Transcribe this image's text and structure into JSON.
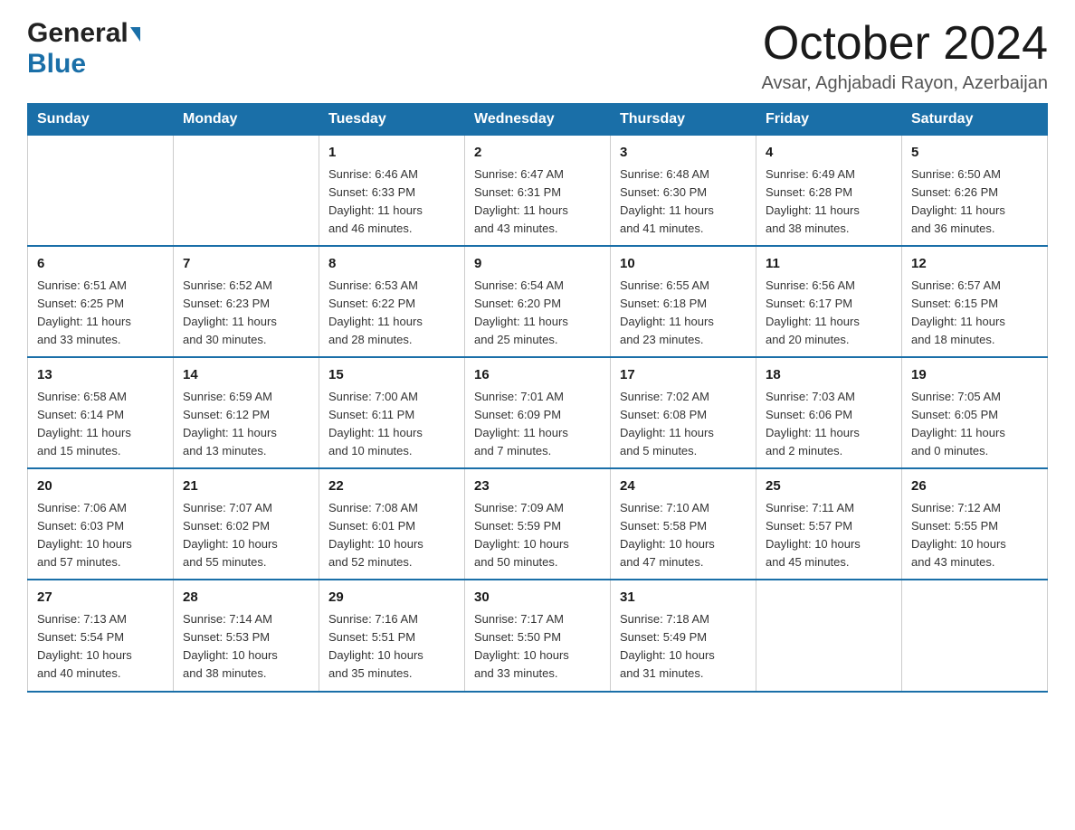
{
  "header": {
    "logo_general": "General",
    "logo_blue": "Blue",
    "month_title": "October 2024",
    "location": "Avsar, Aghjabadi Rayon, Azerbaijan"
  },
  "calendar": {
    "days_of_week": [
      "Sunday",
      "Monday",
      "Tuesday",
      "Wednesday",
      "Thursday",
      "Friday",
      "Saturday"
    ],
    "weeks": [
      [
        {
          "day": "",
          "info": ""
        },
        {
          "day": "",
          "info": ""
        },
        {
          "day": "1",
          "info": "Sunrise: 6:46 AM\nSunset: 6:33 PM\nDaylight: 11 hours\nand 46 minutes."
        },
        {
          "day": "2",
          "info": "Sunrise: 6:47 AM\nSunset: 6:31 PM\nDaylight: 11 hours\nand 43 minutes."
        },
        {
          "day": "3",
          "info": "Sunrise: 6:48 AM\nSunset: 6:30 PM\nDaylight: 11 hours\nand 41 minutes."
        },
        {
          "day": "4",
          "info": "Sunrise: 6:49 AM\nSunset: 6:28 PM\nDaylight: 11 hours\nand 38 minutes."
        },
        {
          "day": "5",
          "info": "Sunrise: 6:50 AM\nSunset: 6:26 PM\nDaylight: 11 hours\nand 36 minutes."
        }
      ],
      [
        {
          "day": "6",
          "info": "Sunrise: 6:51 AM\nSunset: 6:25 PM\nDaylight: 11 hours\nand 33 minutes."
        },
        {
          "day": "7",
          "info": "Sunrise: 6:52 AM\nSunset: 6:23 PM\nDaylight: 11 hours\nand 30 minutes."
        },
        {
          "day": "8",
          "info": "Sunrise: 6:53 AM\nSunset: 6:22 PM\nDaylight: 11 hours\nand 28 minutes."
        },
        {
          "day": "9",
          "info": "Sunrise: 6:54 AM\nSunset: 6:20 PM\nDaylight: 11 hours\nand 25 minutes."
        },
        {
          "day": "10",
          "info": "Sunrise: 6:55 AM\nSunset: 6:18 PM\nDaylight: 11 hours\nand 23 minutes."
        },
        {
          "day": "11",
          "info": "Sunrise: 6:56 AM\nSunset: 6:17 PM\nDaylight: 11 hours\nand 20 minutes."
        },
        {
          "day": "12",
          "info": "Sunrise: 6:57 AM\nSunset: 6:15 PM\nDaylight: 11 hours\nand 18 minutes."
        }
      ],
      [
        {
          "day": "13",
          "info": "Sunrise: 6:58 AM\nSunset: 6:14 PM\nDaylight: 11 hours\nand 15 minutes."
        },
        {
          "day": "14",
          "info": "Sunrise: 6:59 AM\nSunset: 6:12 PM\nDaylight: 11 hours\nand 13 minutes."
        },
        {
          "day": "15",
          "info": "Sunrise: 7:00 AM\nSunset: 6:11 PM\nDaylight: 11 hours\nand 10 minutes."
        },
        {
          "day": "16",
          "info": "Sunrise: 7:01 AM\nSunset: 6:09 PM\nDaylight: 11 hours\nand 7 minutes."
        },
        {
          "day": "17",
          "info": "Sunrise: 7:02 AM\nSunset: 6:08 PM\nDaylight: 11 hours\nand 5 minutes."
        },
        {
          "day": "18",
          "info": "Sunrise: 7:03 AM\nSunset: 6:06 PM\nDaylight: 11 hours\nand 2 minutes."
        },
        {
          "day": "19",
          "info": "Sunrise: 7:05 AM\nSunset: 6:05 PM\nDaylight: 11 hours\nand 0 minutes."
        }
      ],
      [
        {
          "day": "20",
          "info": "Sunrise: 7:06 AM\nSunset: 6:03 PM\nDaylight: 10 hours\nand 57 minutes."
        },
        {
          "day": "21",
          "info": "Sunrise: 7:07 AM\nSunset: 6:02 PM\nDaylight: 10 hours\nand 55 minutes."
        },
        {
          "day": "22",
          "info": "Sunrise: 7:08 AM\nSunset: 6:01 PM\nDaylight: 10 hours\nand 52 minutes."
        },
        {
          "day": "23",
          "info": "Sunrise: 7:09 AM\nSunset: 5:59 PM\nDaylight: 10 hours\nand 50 minutes."
        },
        {
          "day": "24",
          "info": "Sunrise: 7:10 AM\nSunset: 5:58 PM\nDaylight: 10 hours\nand 47 minutes."
        },
        {
          "day": "25",
          "info": "Sunrise: 7:11 AM\nSunset: 5:57 PM\nDaylight: 10 hours\nand 45 minutes."
        },
        {
          "day": "26",
          "info": "Sunrise: 7:12 AM\nSunset: 5:55 PM\nDaylight: 10 hours\nand 43 minutes."
        }
      ],
      [
        {
          "day": "27",
          "info": "Sunrise: 7:13 AM\nSunset: 5:54 PM\nDaylight: 10 hours\nand 40 minutes."
        },
        {
          "day": "28",
          "info": "Sunrise: 7:14 AM\nSunset: 5:53 PM\nDaylight: 10 hours\nand 38 minutes."
        },
        {
          "day": "29",
          "info": "Sunrise: 7:16 AM\nSunset: 5:51 PM\nDaylight: 10 hours\nand 35 minutes."
        },
        {
          "day": "30",
          "info": "Sunrise: 7:17 AM\nSunset: 5:50 PM\nDaylight: 10 hours\nand 33 minutes."
        },
        {
          "day": "31",
          "info": "Sunrise: 7:18 AM\nSunset: 5:49 PM\nDaylight: 10 hours\nand 31 minutes."
        },
        {
          "day": "",
          "info": ""
        },
        {
          "day": "",
          "info": ""
        }
      ]
    ]
  }
}
